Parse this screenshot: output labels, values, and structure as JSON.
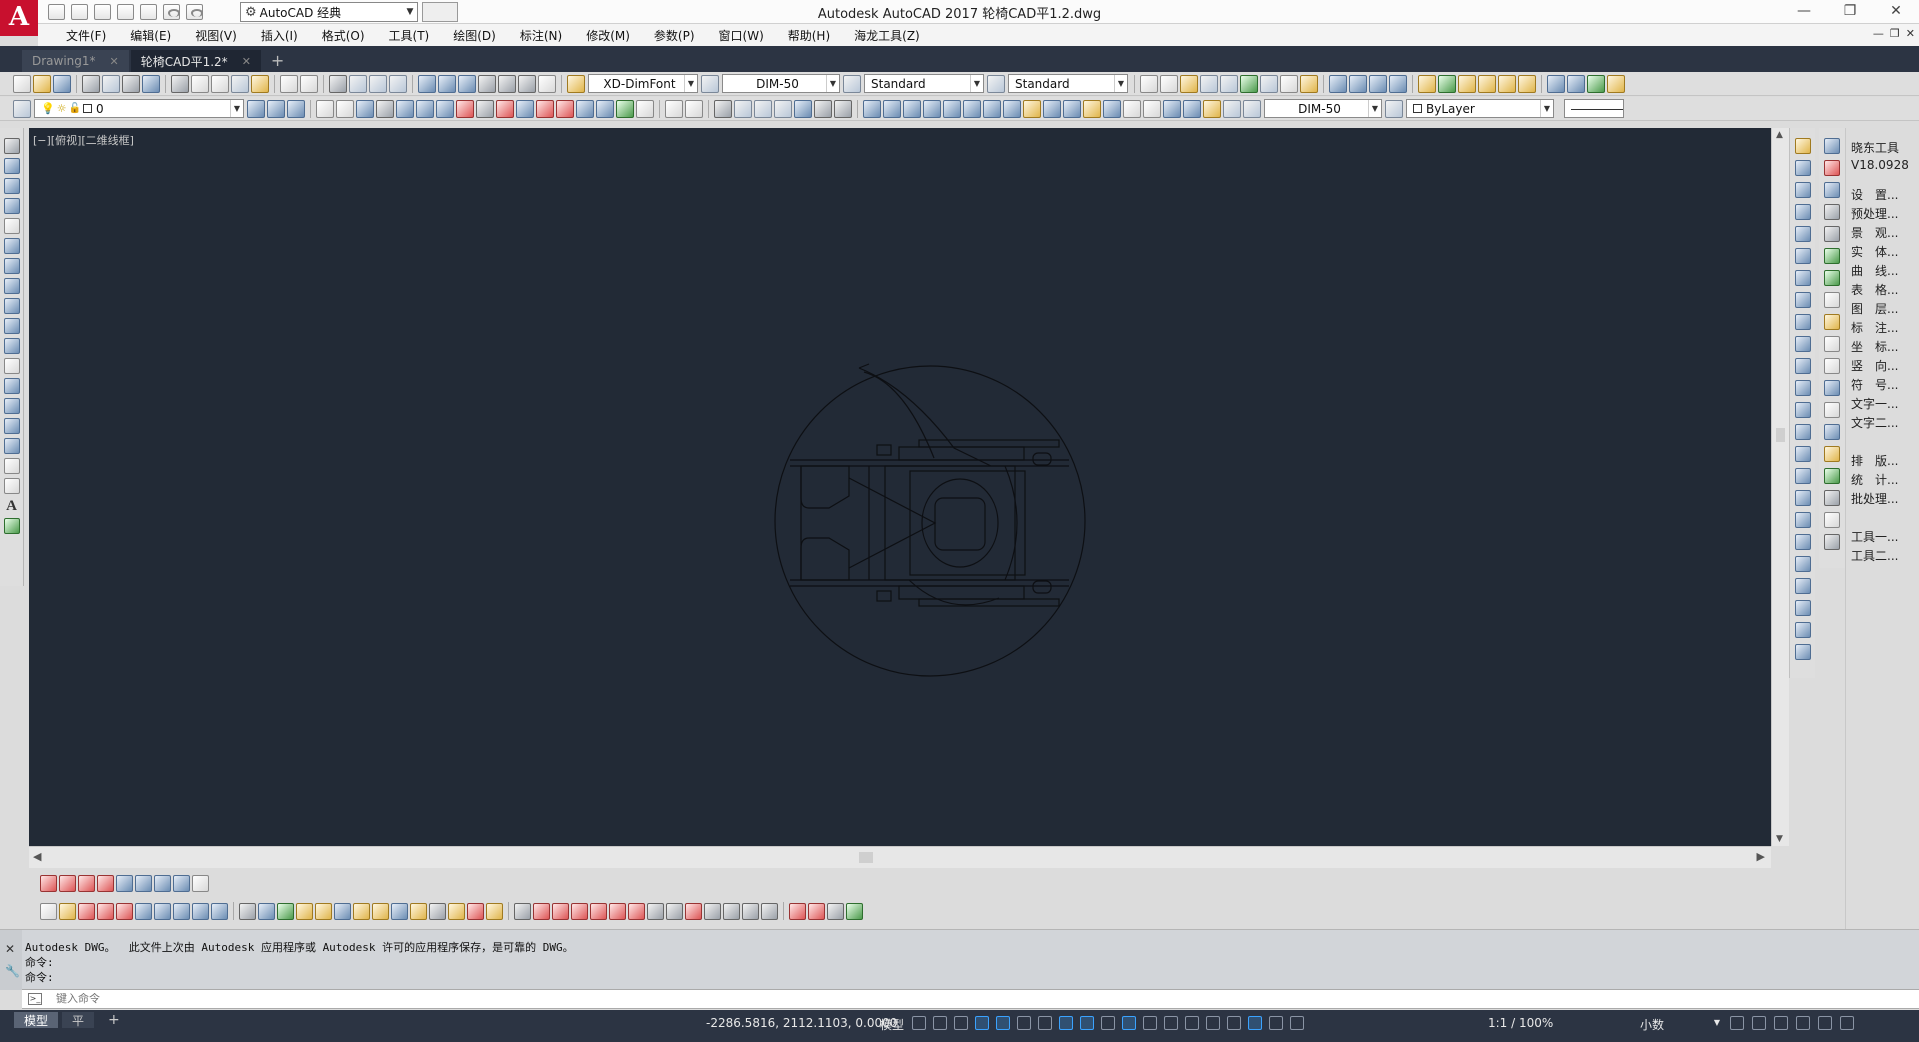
{
  "app": {
    "window_title": "Autodesk AutoCAD 2017     轮椅CAD平1.2.dwg",
    "logo_letter": "A",
    "workspace": "AutoCAD 经典"
  },
  "menu": [
    "文件(F)",
    "编辑(E)",
    "视图(V)",
    "插入(I)",
    "格式(O)",
    "工具(T)",
    "绘图(D)",
    "标注(N)",
    "修改(M)",
    "参数(P)",
    "窗口(W)",
    "帮助(H)",
    "海龙工具(Z)"
  ],
  "file_tabs": [
    {
      "label": "Drawing1*",
      "active": false
    },
    {
      "label": "轮椅CAD平1.2*",
      "active": true
    }
  ],
  "styles": {
    "text_style": "XD-DimFont",
    "dim_style": "DIM-50",
    "table_style": "Standard",
    "mleader_style": "Standard"
  },
  "layers": {
    "current_layer": "0",
    "dim_style_2": "DIM-50",
    "color": "ByLayer"
  },
  "viewport": {
    "label": "[−][俯视][二维线框]"
  },
  "side_panel": {
    "title": "晓东工具",
    "version": "V18.0928",
    "items_group1": [
      "设　置...",
      "预处理...",
      "景　观...",
      "实　体...",
      "曲　线...",
      "表　格...",
      "图　层...",
      "标　注...",
      "坐　标...",
      "竖　向...",
      "符　号...",
      "文字一...",
      "文字二..."
    ],
    "items_group2": [
      "排　版...",
      "统　计...",
      "批处理..."
    ],
    "items_group3": [
      "工具一...",
      "工具二..."
    ]
  },
  "command": {
    "history_line1": "Autodesk DWG。  此文件上次由 Autodesk 应用程序或 Autodesk 许可的应用程序保存，是可靠的 DWG。",
    "history_line2": "命令:",
    "history_line3": "命令:",
    "input_placeholder": "键入命令"
  },
  "status": {
    "layout_tabs": [
      "模型",
      "平",
      "+"
    ],
    "coordinates": "-2286.5816, 2112.1103, 0.0000",
    "model_label": "模型",
    "scale": "1:1 / 100%",
    "units": "小数"
  },
  "colors": {
    "canvas_bg": "#222a36",
    "drawing_lines": "#0d0f13",
    "title_logo": "#c8102e"
  }
}
